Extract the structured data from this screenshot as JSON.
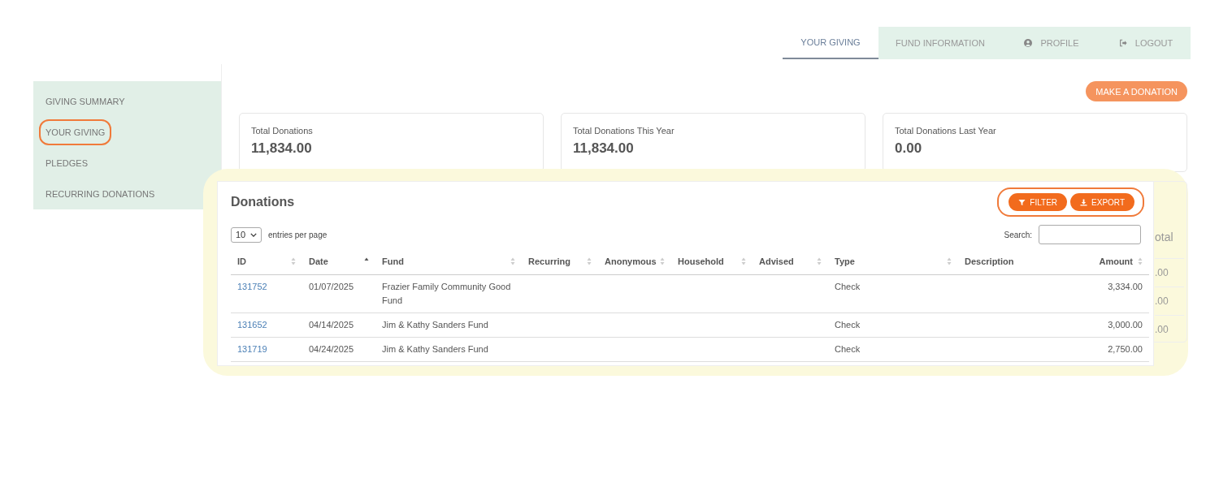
{
  "nav_tabs": [
    {
      "label": "YOUR GIVING",
      "selected": true
    },
    {
      "label": "FUND INFORMATION",
      "selected": false
    },
    {
      "label": "PROFILE",
      "selected": false
    },
    {
      "label": "LOGOUT",
      "selected": false
    }
  ],
  "sidebar": {
    "items": [
      {
        "label": "GIVING SUMMARY",
        "annotated": false
      },
      {
        "label": "YOUR GIVING",
        "annotated": true
      },
      {
        "label": "PLEDGES",
        "annotated": false
      },
      {
        "label": "RECURRING DONATIONS",
        "annotated": false
      }
    ]
  },
  "make_donation_button": "MAKE A DONATION",
  "summary_cards": [
    {
      "label": "Total Donations",
      "value": "11,834.00"
    },
    {
      "label": "Total Donations This Year",
      "value": "11,834.00"
    },
    {
      "label": "Total Donations Last Year",
      "value": "0.00"
    }
  ],
  "background_card": {
    "column_heading": "otal",
    "cells": [
      ".00",
      ".00",
      ".00"
    ]
  },
  "donations": {
    "highlighted": true,
    "title": "Donations",
    "toolbar": {
      "annotated": true,
      "buttons": [
        {
          "label": "FILTER"
        },
        {
          "label": "EXPORT"
        }
      ]
    },
    "page_size": "10",
    "page_size_label": "entries per page",
    "search_label": "Search:",
    "columns": [
      {
        "label": "ID",
        "sortable": true,
        "sorted": false
      },
      {
        "label": "Date",
        "sortable": true,
        "sorted": true
      },
      {
        "label": "Fund",
        "sortable": true,
        "sorted": false
      },
      {
        "label": "Recurring",
        "sortable": true,
        "sorted": false
      },
      {
        "label": "Anonymous",
        "sortable": true,
        "sorted": false
      },
      {
        "label": "Household",
        "sortable": true,
        "sorted": false
      },
      {
        "label": "Advised",
        "sortable": true,
        "sorted": false
      },
      {
        "label": "Type",
        "sortable": true,
        "sorted": false
      },
      {
        "label": "Description",
        "sortable": false
      },
      {
        "label": "Amount",
        "sortable": true,
        "sorted": false
      }
    ],
    "rows": [
      {
        "id": "131752",
        "date": "01/07/2025",
        "fund": "Frazier Family Community Good Fund",
        "type": "Check",
        "amount": "3,334.00"
      },
      {
        "id": "131652",
        "date": "04/14/2025",
        "fund": "Jim & Kathy Sanders Fund",
        "type": "Check",
        "amount": "3,000.00"
      },
      {
        "id": "131719",
        "date": "04/24/2025",
        "fund": "Jim & Kathy Sanders Fund",
        "type": "Check",
        "amount": "2,750.00"
      }
    ]
  }
}
